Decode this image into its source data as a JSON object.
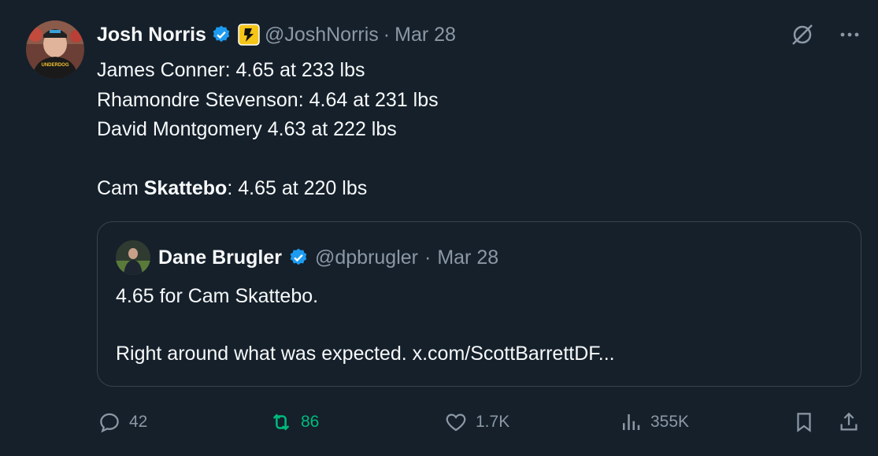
{
  "author": {
    "name": "Josh Norris",
    "handle": "@JoshNorris",
    "date": "Mar 28",
    "shirt_text": "UNDERDOG",
    "verified_icon": "verified-badge-icon",
    "affiliate_icon": "underdog-logo-icon"
  },
  "tweet_lines": [
    "James Conner: 4.65 at 233 lbs",
    "Rhamondre Stevenson: 4.64 at 231 lbs",
    "David Montgomery 4.63 at 222 lbs",
    "",
    {
      "before": "Cam ",
      "bold": "Skattebo",
      "after": ": 4.65 at 220 lbs"
    }
  ],
  "quoted": {
    "name": "Dane Brugler",
    "handle": "@dpbrugler",
    "date": "Mar 28",
    "line1": "4.65 for Cam Skattebo.",
    "line2": "Right around what was expected. x.com/ScottBarrettDF..."
  },
  "actions": {
    "replies": "42",
    "retweets": "86",
    "likes": "1.7K",
    "views": "355K"
  },
  "colors": {
    "background": "#15202b",
    "text": "#f7f9f9",
    "muted": "#8b98a5",
    "verified": "#1d9bf0",
    "retweet_active": "#00ba7c",
    "border": "#38444d"
  }
}
